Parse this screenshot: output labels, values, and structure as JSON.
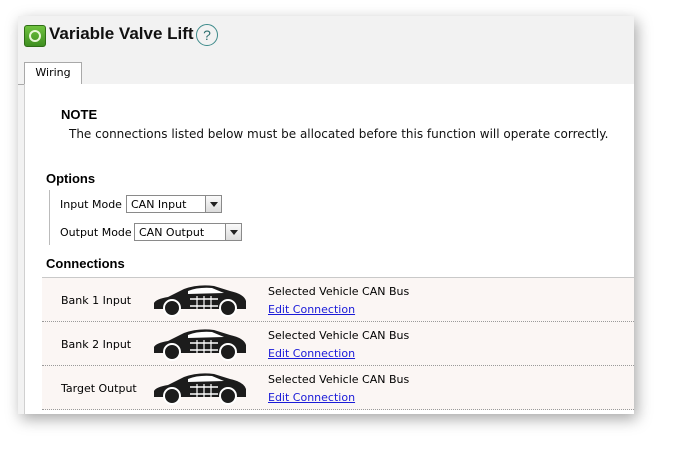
{
  "window": {
    "title": "Variable Valve Lift",
    "help_glyph": "?"
  },
  "tabs": [
    {
      "label": "Wiring",
      "active": true
    }
  ],
  "note": {
    "title": "NOTE",
    "text": "The connections listed below must be allocated before this function will operate correctly."
  },
  "options": {
    "heading": "Options",
    "input_mode": {
      "label": "Input Mode",
      "value": "CAN Input"
    },
    "output_mode": {
      "label": "Output Mode",
      "value": "CAN Output"
    }
  },
  "connections": {
    "heading": "Connections",
    "rows": [
      {
        "label": "Bank 1 Input",
        "bus": "Selected Vehicle CAN Bus",
        "link": "Edit Connection",
        "icon": "car-can-icon"
      },
      {
        "label": "Bank 2 Input",
        "bus": "Selected Vehicle CAN Bus",
        "link": "Edit Connection",
        "icon": "car-can-icon"
      },
      {
        "label": "Target Output",
        "bus": "Selected Vehicle CAN Bus",
        "link": "Edit Connection",
        "icon": "car-can-icon"
      }
    ]
  },
  "colors": {
    "row_bg": "#fbf6f4",
    "link": "#1a1ad8",
    "icon_green": "#4fa72b",
    "panel_bg": "#f2f2f2"
  }
}
